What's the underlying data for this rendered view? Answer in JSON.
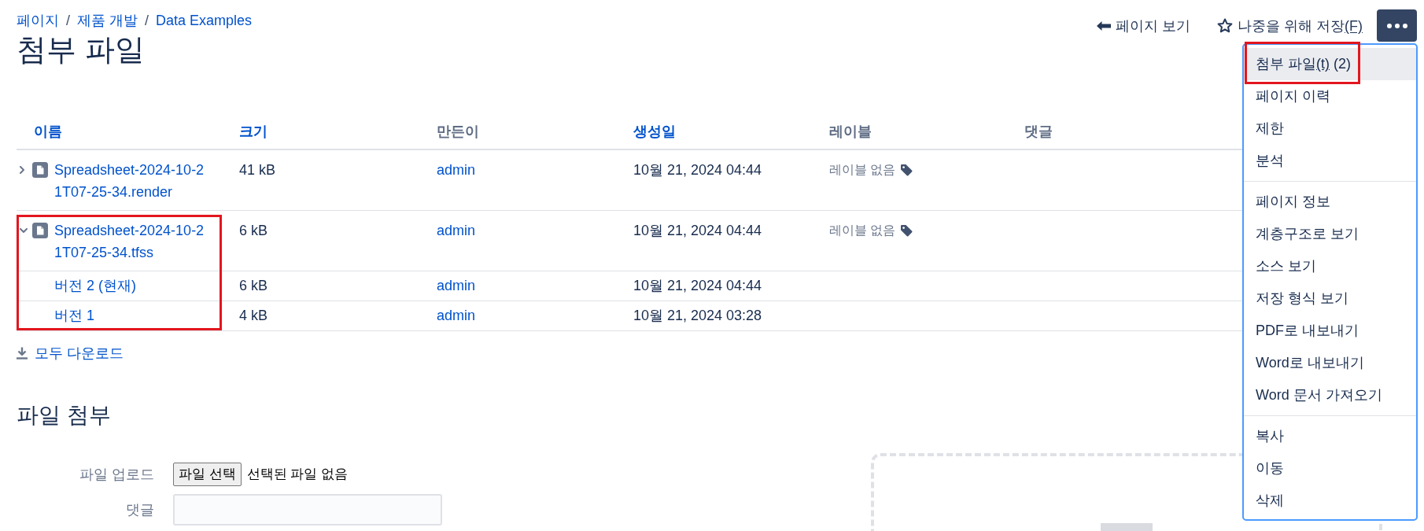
{
  "breadcrumb": {
    "items": [
      "페이지",
      "제품 개발",
      "Data Examples"
    ],
    "separators": [
      "/",
      "/"
    ]
  },
  "title": "첨부 파일",
  "actions": {
    "view_page": "페이지 보기",
    "save_for_later": {
      "label": "나중을 위해 저장",
      "accesskey": "(F)"
    }
  },
  "more_menu": {
    "open": true,
    "sections": [
      {
        "items": [
          {
            "label": "첨부 파일",
            "accesskey": "(t)",
            "count": "(2)",
            "selected": true,
            "annotated": true
          },
          {
            "label": "페이지 이력",
            "selected": false,
            "annotated": false
          },
          {
            "label": "제한",
            "selected": false,
            "annotated": false
          },
          {
            "label": "분석",
            "selected": false,
            "annotated": false
          }
        ]
      },
      {
        "items": [
          {
            "label": "페이지 정보",
            "selected": false,
            "annotated": false
          },
          {
            "label": "계층구조로 보기",
            "selected": false,
            "annotated": false
          },
          {
            "label": "소스 보기",
            "selected": false,
            "annotated": false
          },
          {
            "label": "저장 형식 보기",
            "selected": false,
            "annotated": false
          },
          {
            "label": "PDF로 내보내기",
            "selected": false,
            "annotated": false
          },
          {
            "label": "Word로 내보내기",
            "selected": false,
            "annotated": false
          },
          {
            "label": "Word 문서 가져오기",
            "selected": false,
            "annotated": false
          }
        ]
      },
      {
        "items": [
          {
            "label": "복사",
            "selected": false,
            "annotated": false
          },
          {
            "label": "이동",
            "selected": false,
            "annotated": false
          },
          {
            "label": "삭제",
            "selected": false,
            "annotated": false
          }
        ]
      }
    ]
  },
  "table": {
    "columns": [
      {
        "label": "이름",
        "sortable": true
      },
      {
        "label": "크기",
        "sortable": true
      },
      {
        "label": "만든이",
        "sortable": false
      },
      {
        "label": "생성일",
        "sortable": true
      },
      {
        "label": "레이블",
        "sortable": false
      },
      {
        "label": "댓글",
        "sortable": false
      }
    ],
    "files": [
      {
        "name": "Spreadsheet-2024-10-21T07-25-34.render",
        "size": "41 kB",
        "creator": "admin",
        "created": "10월 21, 2024 04:44",
        "labels": "레이블 없음",
        "expanded": false,
        "annotated": false
      },
      {
        "name": "Spreadsheet-2024-10-21T07-25-34.tfss",
        "size": "6 kB",
        "creator": "admin",
        "created": "10월 21, 2024 04:44",
        "labels": "레이블 없음",
        "expanded": true,
        "annotated": true,
        "versions": [
          {
            "name": "버전 2 (현재)",
            "size": "6 kB",
            "creator": "admin",
            "created": "10월 21, 2024 04:44"
          },
          {
            "name": "버전 1",
            "size": "4 kB",
            "creator": "admin",
            "created": "10월 21, 2024 03:28"
          }
        ]
      }
    ]
  },
  "download_all": "모두 다운로드",
  "attach": {
    "title": "파일 첨부",
    "upload_label": "파일 업로드",
    "choose_button": "파일 선택",
    "no_file": "선택된 파일 없음",
    "comment_label": "댓글"
  }
}
